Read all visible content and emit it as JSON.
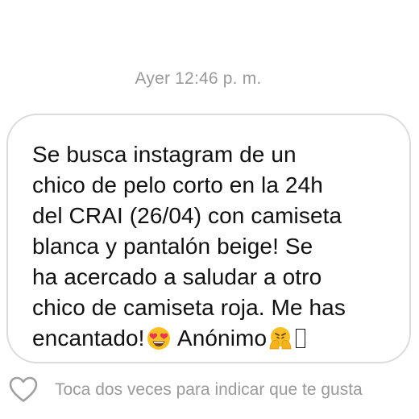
{
  "thread": {
    "timestamp": "Ayer 12:46 p. m."
  },
  "message": {
    "lines": [
      "Se busca instagram de un",
      "chico de pelo corto en la 24h",
      "del CRAI (26/04) con camiseta",
      "blanca y pantalón beige! Se",
      "ha acercado a saludar a otro",
      "chico de camiseta roja. Me has"
    ],
    "last_line_start": "encantado!",
    "last_line_end": " Anónimo",
    "emojis": [
      "heart-eyes-emoji",
      "pleading-hands-emoji",
      "unrendered-glyph"
    ]
  },
  "like_row": {
    "icon": "heart-outline-icon",
    "hint": "Toca dos veces para indicar que te gusta"
  },
  "colors": {
    "text": "#111111",
    "meta_text": "#9a9a9a",
    "bubble_border": "#dcdcdc",
    "emoji_yellow": "#f6c026",
    "emoji_heart": "#e8364f"
  }
}
